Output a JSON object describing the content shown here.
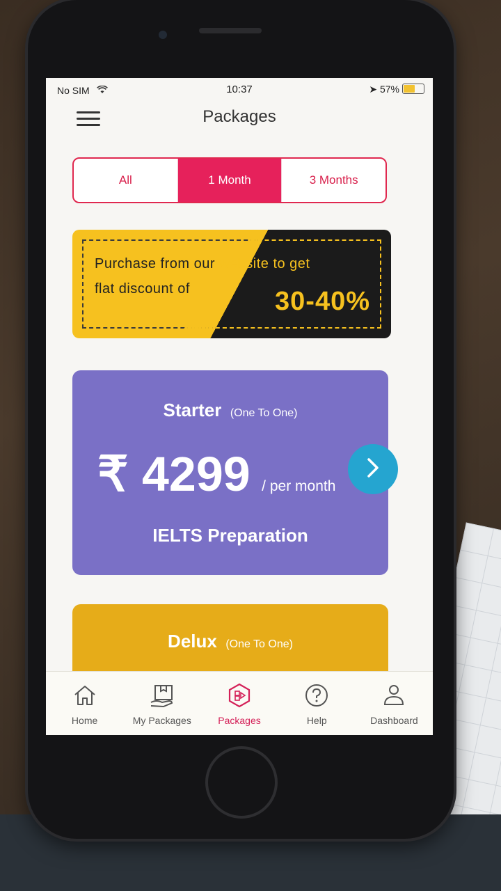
{
  "statusbar": {
    "carrier": "No SIM",
    "time": "10:37",
    "battery": "57%",
    "battery_level": 0.57
  },
  "header": {
    "title": "Packages"
  },
  "tabs": [
    {
      "label": "All",
      "active": false
    },
    {
      "label": "1 Month",
      "active": true
    },
    {
      "label": "3 Months",
      "active": false
    }
  ],
  "promo": {
    "line1_a": "Purchase from our",
    "line1_b": "website to get",
    "line2": "flat discount of",
    "percent": "30-40%"
  },
  "packages": [
    {
      "name": "Starter",
      "type": "(One To One)",
      "price": "₹ 4299",
      "period": "/ per month",
      "course": "IELTS Preparation",
      "color": "#7a70c6"
    },
    {
      "name": "Delux",
      "type": "(One To One)",
      "color": "#e6ac19"
    }
  ],
  "bottom_nav": [
    {
      "label": "Home",
      "icon": "home-icon"
    },
    {
      "label": "My Packages",
      "icon": "box-icon"
    },
    {
      "label": "Packages",
      "icon": "packages-icon",
      "active": true
    },
    {
      "label": "Help",
      "icon": "help-icon"
    },
    {
      "label": "Dashboard",
      "icon": "user-icon"
    }
  ],
  "colors": {
    "accent": "#e6215b",
    "promo_yellow": "#f6c11f",
    "next_button": "#25a5d0"
  }
}
